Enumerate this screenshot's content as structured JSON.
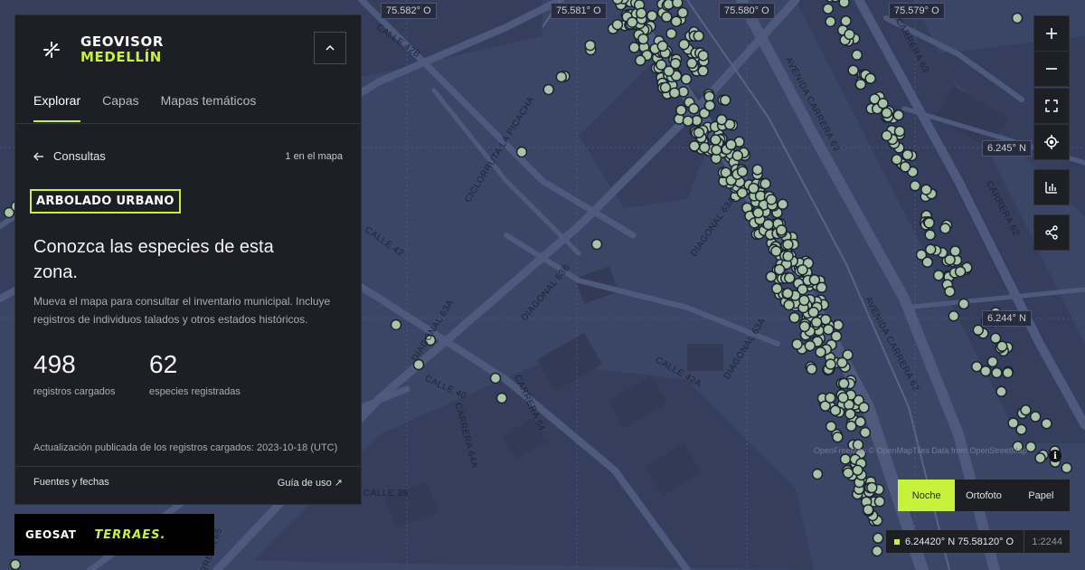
{
  "app": {
    "brand_line1": "GEOVISOR",
    "brand_line2": "MEDELLÍN"
  },
  "tabs": [
    {
      "label": "Explorar",
      "active": true
    },
    {
      "label": "Capas",
      "active": false
    },
    {
      "label": "Mapas temáticos",
      "active": false
    }
  ],
  "panel": {
    "back_label": "Consultas",
    "count_on_map": "1 en el mapa",
    "layer_badge": "ARBOLADO URBANO",
    "headline": "Conozca las especies de esta zona.",
    "description": "Mueva el mapa para consultar el inventario municipal. Incluye registros de individuos talados y otros estados históricos.",
    "stats": [
      {
        "value": "498",
        "label": "registros cargados"
      },
      {
        "value": "62",
        "label": "especies registradas"
      }
    ],
    "update_note": "Actualización publicada de los registros cargados: 2023-10-18 (UTC)",
    "footer_left": "Fuentes y fechas",
    "footer_right": "Guía de uso ↗"
  },
  "logos": {
    "geosat": "GEOSAT",
    "terraes": "TERRAES."
  },
  "map": {
    "graticule_top": [
      "75.582° O",
      "75.581° O",
      "75.580° O",
      "75.579° O"
    ],
    "graticule_right": [
      "6.245° N",
      "6.244° N"
    ],
    "street_labels": [
      "CALLE 42B",
      "CICLORRUTA LA PICACHA",
      "CALLE 42",
      "DIAGONAL 63B",
      "DIAGONAL 63A",
      "DIAGONAL 63A",
      "DIAGONAL 63A",
      "CALLE 42A",
      "CALLE 40",
      "CARRERA 64",
      "CARRERA 64A",
      "CALLE 39",
      "AVENIDA CARRERA 63",
      "AVENIDA CARRERA 62",
      "CARRERA 63",
      "CARRERA 62",
      "CARRERA 65"
    ],
    "attribution": "OpenFreeMap © OpenMapTiles Data from OpenStreetMap",
    "colors": {
      "background": "#3b4566",
      "tree_point": "#a8c4a6",
      "accent": "#c7f23c"
    }
  },
  "controls": [
    {
      "name": "zoom-in-button",
      "icon": "plus-icon"
    },
    {
      "name": "zoom-out-button",
      "icon": "minus-icon"
    },
    {
      "name": "fullscreen-button",
      "icon": "expand-icon"
    },
    {
      "name": "locate-button",
      "icon": "crosshair-icon"
    },
    {
      "name": "stats-button",
      "icon": "bar-chart-icon"
    },
    {
      "name": "share-button",
      "icon": "share-icon"
    }
  ],
  "basemap": {
    "options": [
      "Noche",
      "Ortofoto",
      "Papel"
    ],
    "selected": "Noche"
  },
  "status": {
    "coordinates": "6.24420° N 75.58120° O",
    "scale": "1:2244"
  }
}
